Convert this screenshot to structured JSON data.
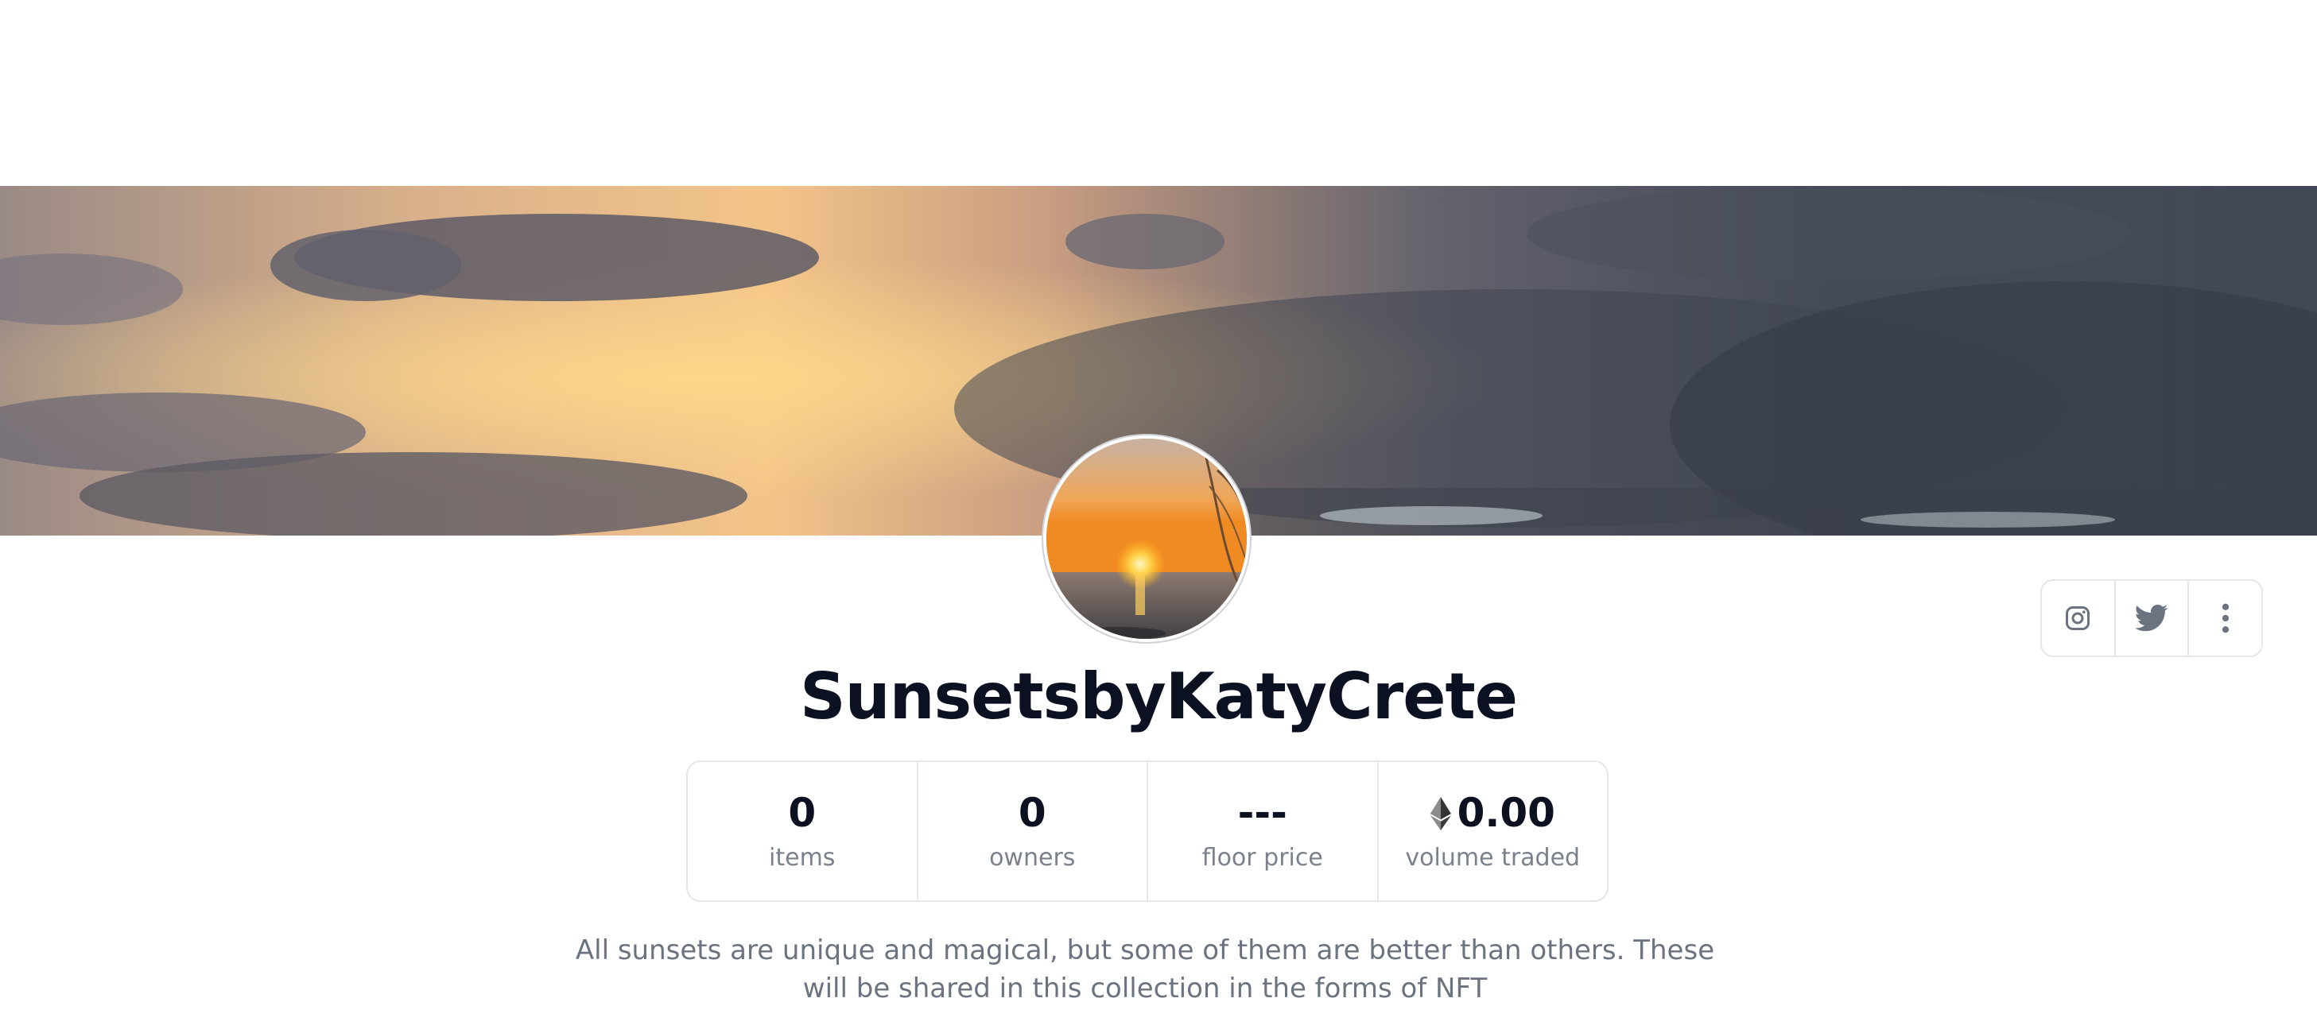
{
  "collection": {
    "name": "SunsetsbyKatyCrete",
    "description": "All sunsets are unique and magical, but some of them are better than others. These will be shared in this collection in the forms of NFT",
    "banner_image": "cloudy-sunset-sky-banner",
    "avatar_image": "sunset-over-sea-avatar"
  },
  "social": {
    "instagram_icon": "instagram-icon",
    "twitter_icon": "twitter-icon",
    "more_icon": "more-vertical-icon"
  },
  "stats": {
    "items": {
      "value": "0",
      "label": "items"
    },
    "owners": {
      "value": "0",
      "label": "owners"
    },
    "floor_price": {
      "value": "---",
      "label": "floor price"
    },
    "volume_traded": {
      "value": "0.00",
      "label": "volume traded",
      "currency_icon": "ethereum-icon"
    }
  },
  "colors": {
    "title": "#0b1120",
    "label": "#7a818c",
    "border": "#e3e6ea",
    "description": "#6b7280",
    "icon": "#6b7280"
  }
}
